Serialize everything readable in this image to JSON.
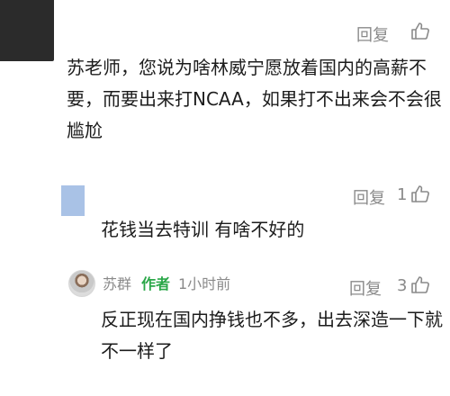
{
  "comment1": {
    "text_lines": [
      "苏老师，您说为啥林威宁愿放着国内的高薪不",
      "要，而要出来打NCAA，如果打不出来会不会很",
      "尴尬"
    ],
    "reply_label": "回复"
  },
  "comment2": {
    "text": "花钱当去特训 有啥不好的",
    "reply_label": "回复",
    "like_count": "1"
  },
  "comment3": {
    "author_name": "苏群",
    "author_tag": "作者",
    "time": "1小时前",
    "text_lines": [
      "反正现在国内挣钱也不多，出去深造一下就",
      "不一样了"
    ],
    "reply_label": "回复",
    "like_count": "3"
  }
}
